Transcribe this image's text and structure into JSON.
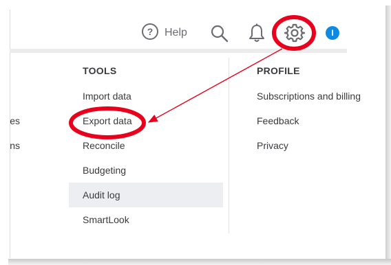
{
  "toolbar": {
    "help_label": "Help",
    "avatar_initial": "I"
  },
  "colors": {
    "accent": "#0f8ae0",
    "annotation": "#e8001d",
    "text": "#393a3d",
    "muted": "#6b6c72",
    "active_bg": "#eceef1"
  },
  "icons": [
    "help-circle-icon",
    "search-icon",
    "bell-icon",
    "gear-icon"
  ],
  "left_column": {
    "items": [
      "es",
      "ns"
    ]
  },
  "tools": {
    "heading": "TOOLS",
    "items": [
      {
        "label": "Import data"
      },
      {
        "label": "Export data"
      },
      {
        "label": "Reconcile"
      },
      {
        "label": "Budgeting"
      },
      {
        "label": "Audit log",
        "active": true
      },
      {
        "label": "SmartLook"
      }
    ]
  },
  "profile": {
    "heading": "PROFILE",
    "items": [
      {
        "label": "Subscriptions and billing"
      },
      {
        "label": "Feedback"
      },
      {
        "label": "Privacy"
      }
    ]
  }
}
